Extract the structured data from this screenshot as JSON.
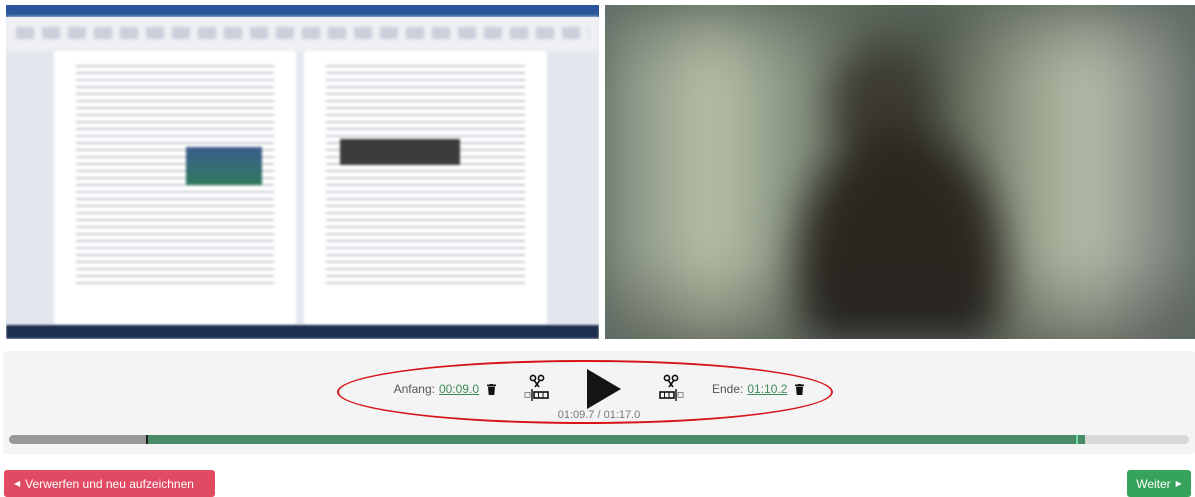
{
  "previews": {
    "screen": {
      "label": "screen-recording-preview"
    },
    "camera": {
      "label": "webcam-preview"
    }
  },
  "controls": {
    "start_label": "Anfang:",
    "start_time": "00:09.0",
    "end_label": "Ende:",
    "end_time": "01:10.2",
    "current_time": "01:09.7",
    "separator": " / ",
    "total_time": "01:17.0",
    "icons": {
      "delete_start": "trash-icon",
      "cut_start": "cut-start-icon",
      "play": "play-icon",
      "cut_end": "cut-end-icon",
      "delete_end": "trash-icon"
    }
  },
  "timeline": {
    "total_seconds": 77.0,
    "start_seconds": 9.0,
    "end_seconds": 70.2,
    "current_seconds": 69.7,
    "colors": {
      "track": "#d8d8d8",
      "played": "#989898",
      "selection": "#4a8a68",
      "playhead": "#6fdc9a"
    }
  },
  "buttons": {
    "discard_label": "Verwerfen und neu aufzeichnen",
    "next_label": "Weiter",
    "discard_color": "#e04a62",
    "next_color": "#36a35a"
  }
}
